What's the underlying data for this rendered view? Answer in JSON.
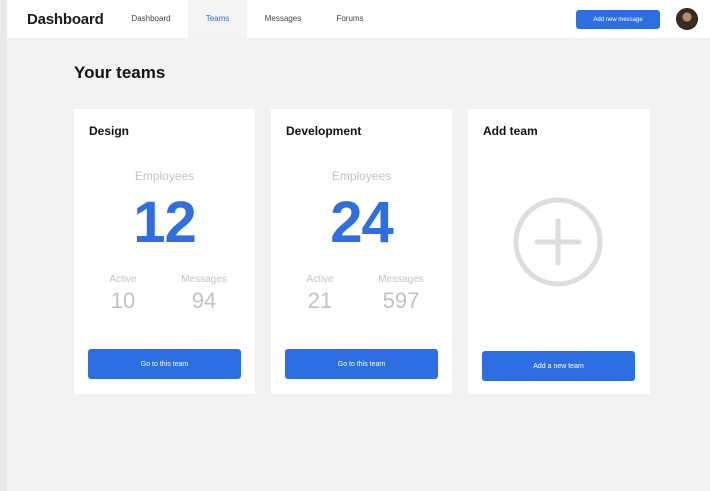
{
  "brand": "Dashboard",
  "nav": {
    "dashboard": "Dashboard",
    "teams": "Teams",
    "messages": "Messages",
    "forums": "Forums"
  },
  "header": {
    "add_message_label": "Add new message",
    "avatar_icon": "user-avatar"
  },
  "page_title": "Your teams",
  "teams": [
    {
      "name": "Design",
      "employees_label": "Employees",
      "employees": "12",
      "active_label": "Active",
      "active": "10",
      "messages_label": "Messages",
      "messages": "94",
      "button_label": "Go to this team"
    },
    {
      "name": "Development",
      "employees_label": "Employees",
      "employees": "24",
      "active_label": "Active",
      "active": "21",
      "messages_label": "Messages",
      "messages": "597",
      "button_label": "Go to this team"
    }
  ],
  "add_team": {
    "title": "Add team",
    "icon": "plus-circle-icon",
    "button_label": "Add a new team"
  },
  "colors": {
    "accent": "#2d6fe3",
    "muted": "#c4c4c4",
    "background": "#f2f2f2"
  }
}
